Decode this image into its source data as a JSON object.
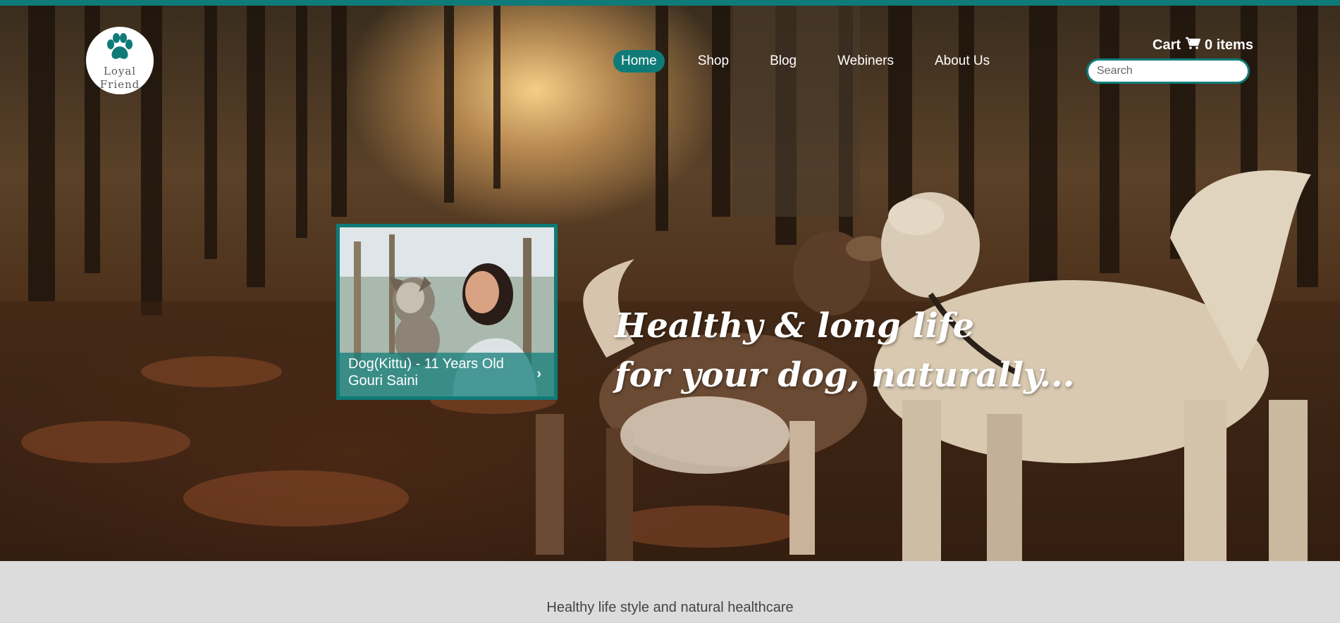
{
  "logo": {
    "line1": "Loyal",
    "line2": "Friend",
    "icon": "paw-icon"
  },
  "nav": {
    "items": [
      {
        "label": "Home",
        "active": true
      },
      {
        "label": "Shop",
        "active": false
      },
      {
        "label": "Blog",
        "active": false
      },
      {
        "label": "Webiners",
        "active": false
      },
      {
        "label": "About Us",
        "active": false
      }
    ]
  },
  "cart": {
    "label": "Cart",
    "icon": "cart-icon",
    "count_text": "0 items"
  },
  "search": {
    "placeholder": "Search"
  },
  "feature_card": {
    "line1": "Dog(Kittu) - 11 Years Old",
    "line2": "Gouri Saini",
    "arrow_icon": "chevron-right-icon"
  },
  "hero": {
    "tagline_line1": "Healthy & long life",
    "tagline_line2": "for your dog, naturally..."
  },
  "section": {
    "subtitle": "Healthy life style and natural healthcare"
  },
  "colors": {
    "accent": "#0f7b78",
    "section_bg": "#dcdcdc"
  }
}
